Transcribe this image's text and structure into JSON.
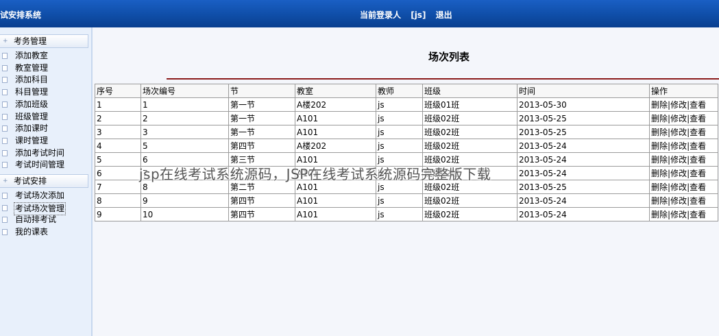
{
  "header": {
    "app_title": "试安排系统",
    "current_user_label": "当前登录人",
    "current_user": "[js]",
    "logout_label": "退出"
  },
  "sidebar": {
    "sections": [
      {
        "title": "考务管理",
        "items": [
          "添加教室",
          "教室管理",
          "添加科目",
          "科目管理",
          "添加班级",
          "班级管理",
          "添加课时",
          "课时管理",
          "添加考试时间",
          "考试时间管理"
        ]
      },
      {
        "title": "考试安排",
        "items": [
          "考试场次添加",
          "考试场次管理",
          "自动排考试",
          "我的课表"
        ]
      }
    ],
    "active_item": "考试场次管理"
  },
  "main": {
    "title": "场次列表",
    "columns": [
      "序号",
      "场次编号",
      "节",
      "教室",
      "教师",
      "班级",
      "时间",
      "操作"
    ],
    "rows": [
      [
        "1",
        "1",
        "第一节",
        "A楼202",
        "js",
        "班级01班",
        "2013-05-30"
      ],
      [
        "2",
        "2",
        "第一节",
        "A101",
        "js",
        "班级02班",
        "2013-05-25"
      ],
      [
        "3",
        "3",
        "第一节",
        "A101",
        "js",
        "班级02班",
        "2013-05-25"
      ],
      [
        "4",
        "5",
        "第四节",
        "A楼202",
        "js",
        "班级02班",
        "2013-05-24"
      ],
      [
        "5",
        "6",
        "第三节",
        "A101",
        "js",
        "班级02班",
        "2013-05-24"
      ],
      [
        "6",
        "7",
        "",
        "A101",
        "js",
        "班级02班",
        "2013-05-24"
      ],
      [
        "7",
        "8",
        "第二节",
        "A101",
        "js",
        "班级02班",
        "2013-05-25"
      ],
      [
        "8",
        "9",
        "第四节",
        "A101",
        "js",
        "班级02班",
        "2013-05-24"
      ],
      [
        "9",
        "10",
        "第四节",
        "A101",
        "js",
        "班级02班",
        "2013-05-24"
      ]
    ],
    "actions": [
      "删除",
      "修改",
      "查看"
    ],
    "action_separator": "|"
  },
  "watermark": "jsp在线考试系统源码，JSP在线考试系统源码完整版下载"
}
